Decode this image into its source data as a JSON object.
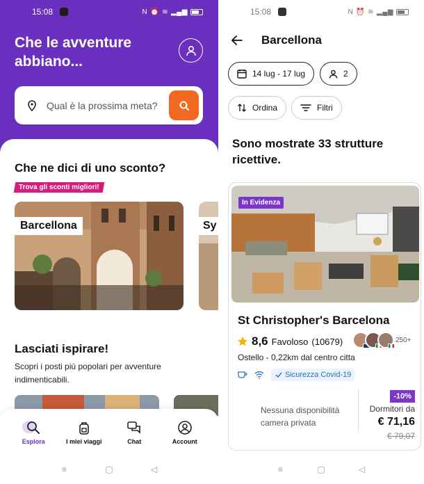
{
  "left": {
    "status": {
      "time": "15:08"
    },
    "header": {
      "title": "Che le avventure abbiano..."
    },
    "search": {
      "placeholder": "Qual è la prossima meta?"
    },
    "discount_section": {
      "title": "Che ne dici di uno sconto?",
      "badge": "Trova gli sconti migliori!",
      "cities": [
        "Barcellona",
        "Sy"
      ]
    },
    "inspire_section": {
      "title": "Lasciati ispirare!",
      "text": "Scopri i posti più popolari per avventure indimenticabili."
    },
    "tabbar": {
      "items": [
        {
          "label": "Esplora",
          "icon": "search-icon",
          "active": true
        },
        {
          "label": "I miei viaggi",
          "icon": "backpack-icon"
        },
        {
          "label": "Chat",
          "icon": "chat-icon"
        },
        {
          "label": "Account",
          "icon": "account-icon"
        }
      ]
    }
  },
  "right": {
    "status": {
      "time": "15:08"
    },
    "header": {
      "title": "Barcellona"
    },
    "filters": {
      "dates": "14 lug - 17 lug",
      "guests": "2",
      "sort": "Ordina",
      "filter": "Filtri"
    },
    "results_text": "Sono mostrate 33 strutture ricettive.",
    "property": {
      "badge": "In Evidenza",
      "name": "St Christopher's Barcelona",
      "score": "8,6",
      "rating_label": "Favoloso",
      "reviews": "(10679)",
      "guests_more": "250+",
      "type_distance": "Ostello - 0,22km dal centro citta",
      "covid": "Sicurezza Covid-19",
      "private_room": "Nessuna disponibilità camera privata",
      "discount": "-10%",
      "dorm_label": "Dormitori da",
      "price": "€ 71,16",
      "old_price": "€ 79,07"
    }
  },
  "colors": {
    "brand_purple": "#6b2fc0",
    "search_orange": "#f26a21",
    "promo_pink": "#d81b7a",
    "badge_purple": "#7b35c9"
  }
}
